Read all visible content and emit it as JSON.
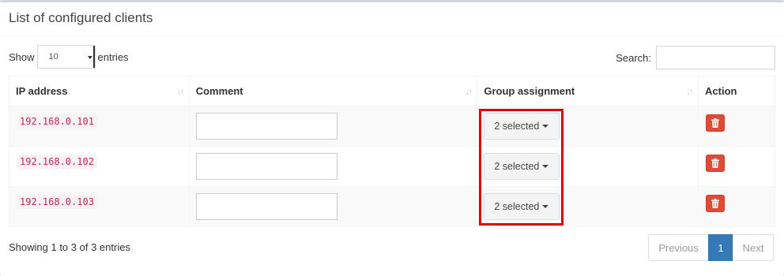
{
  "header": {
    "title": "List of configured clients"
  },
  "length": {
    "show_label": "Show",
    "value": "10",
    "entries_label": "entries"
  },
  "search": {
    "label": "Search:",
    "value": ""
  },
  "table": {
    "columns": [
      "IP address",
      "Comment",
      "Group assignment",
      "Action"
    ],
    "rows": [
      {
        "ip": "192.168.0.101",
        "comment": "",
        "group": "2 selected"
      },
      {
        "ip": "192.168.0.102",
        "comment": "",
        "group": "2 selected"
      },
      {
        "ip": "192.168.0.103",
        "comment": "",
        "group": "2 selected"
      }
    ]
  },
  "footer": {
    "info": "Showing 1 to 3 of 3 entries",
    "pagination": {
      "previous": "Previous",
      "current": "1",
      "next": "Next"
    }
  },
  "colors": {
    "delete": "#dd4b39",
    "ip_text": "#c7254e",
    "page_active": "#337ab7",
    "highlight": "#e00000"
  },
  "icons": {
    "sort": "sort-icon",
    "delete": "trash-icon",
    "dropdown": "caret-down-icon"
  }
}
